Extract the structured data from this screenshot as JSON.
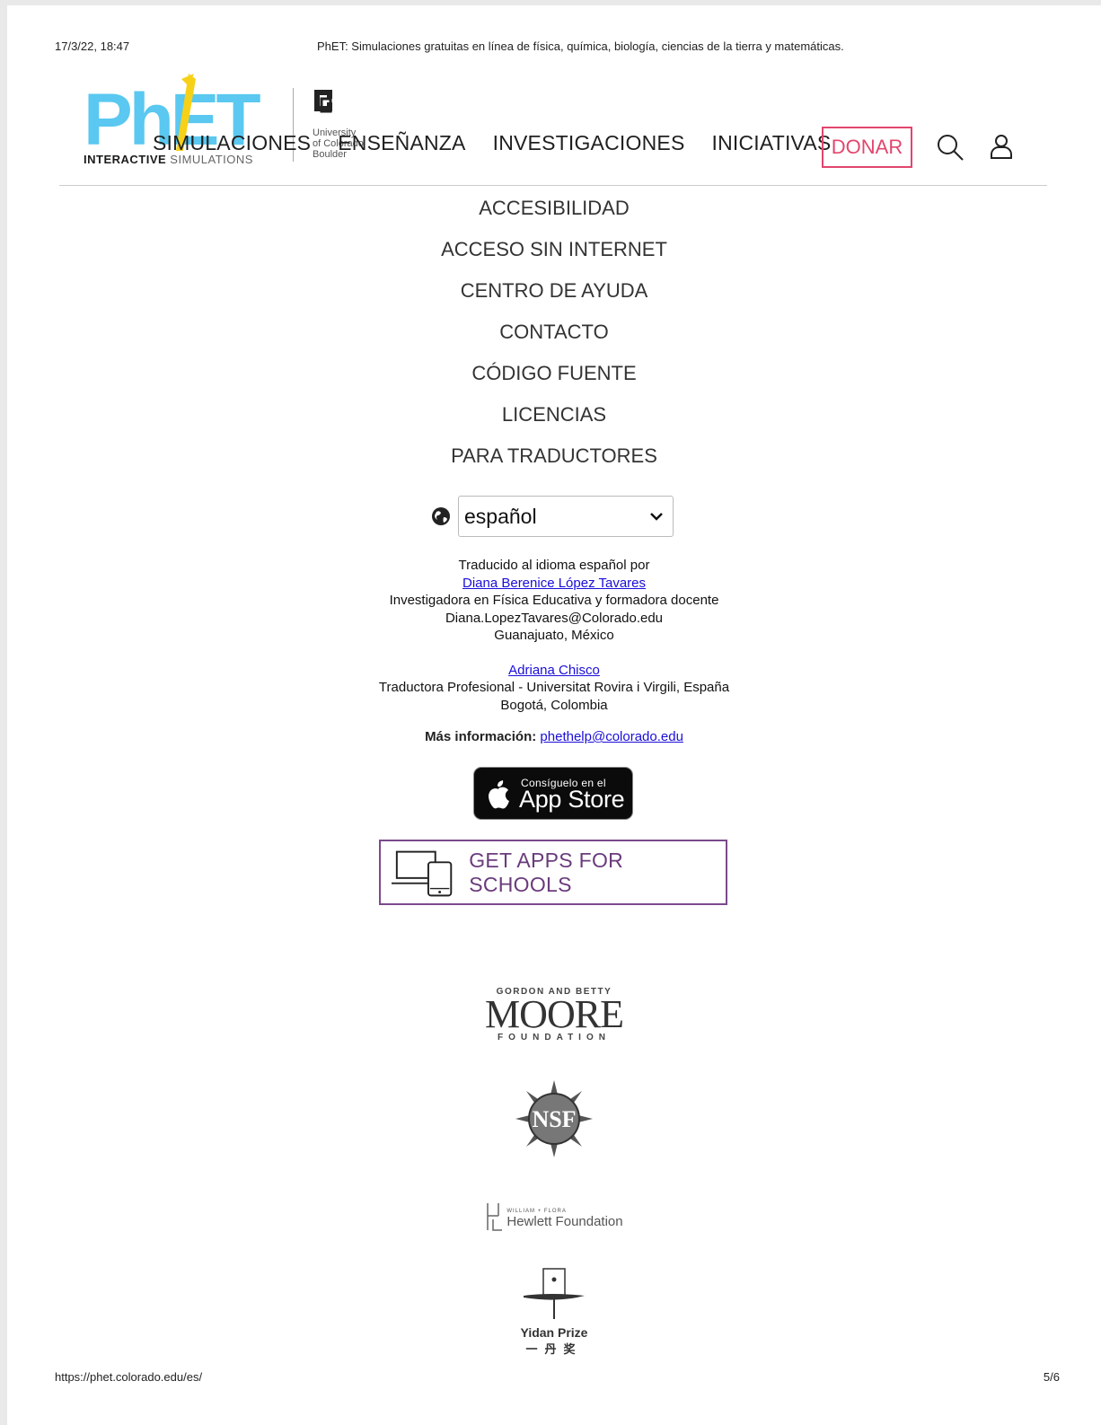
{
  "print_header": {
    "datetime": "17/3/22, 18:47",
    "title": "PhET: Simulaciones gratuitas en línea de física, química, biología, ciencias de la tierra y matemáticas."
  },
  "nav": {
    "logo_text": "PhET",
    "logo_sub_bold": "INTERACTIVE",
    "logo_sub_light": " SIMULATIONS",
    "cu_text": [
      "University",
      "of Colorado",
      "Boulder"
    ],
    "links": [
      "SIMULACIONES",
      "ENSEÑANZA",
      "INVESTIGACIONES",
      "INICIATIVAS"
    ],
    "donate_label": "DONAR",
    "search_icon": "search-icon",
    "user_icon": "user-icon"
  },
  "footer_links": [
    "ACCESIBILIDAD",
    "ACCESO SIN INTERNET",
    "CENTRO DE AYUDA",
    "CONTACTO",
    "CÓDIGO FUENTE",
    "LICENCIAS",
    "PARA TRADUCTORES"
  ],
  "language": {
    "selected": "español"
  },
  "credits": {
    "intro": "Traducido al idioma español por",
    "translator1_name": "Diana Berenice López Tavares",
    "translator1_role": "Investigadora en Física Educativa y formadora docente",
    "translator1_email": "Diana.LopezTavares@Colorado.edu",
    "translator1_location": "Guanajuato, México",
    "translator2_name": "Adriana Chisco",
    "translator2_role": "Traductora Profesional - Universitat Rovira i Virgili, España",
    "translator2_location": "Bogotá, Colombia"
  },
  "more_info": {
    "label": "Más información:",
    "email": "phethelp@colorado.edu"
  },
  "app_store": {
    "small": "Consíguelo en el",
    "big": "App Store"
  },
  "apps_for_schools": {
    "label": "GET APPS FOR SCHOOLS"
  },
  "sponsors": {
    "moore_small": "GORDON AND BETTY",
    "moore_big": "MOORE",
    "moore_found": "FOUNDATION",
    "nsf": "NSF",
    "hewlett_small": "WILLIAM + FLORA",
    "hewlett_big": "Hewlett Foundation",
    "yidan_name": "Yidan Prize",
    "yidan_cn": "一丹奖"
  },
  "print_footer": {
    "url": "https://phet.colorado.edu/es/",
    "page": "5/6"
  },
  "colors": {
    "donate": "#e2466e",
    "link": "#1a0dd9",
    "schools": "#6a3b7c",
    "phet_blue": "#5ac8f0",
    "phet_yellow": "#f7d117"
  }
}
